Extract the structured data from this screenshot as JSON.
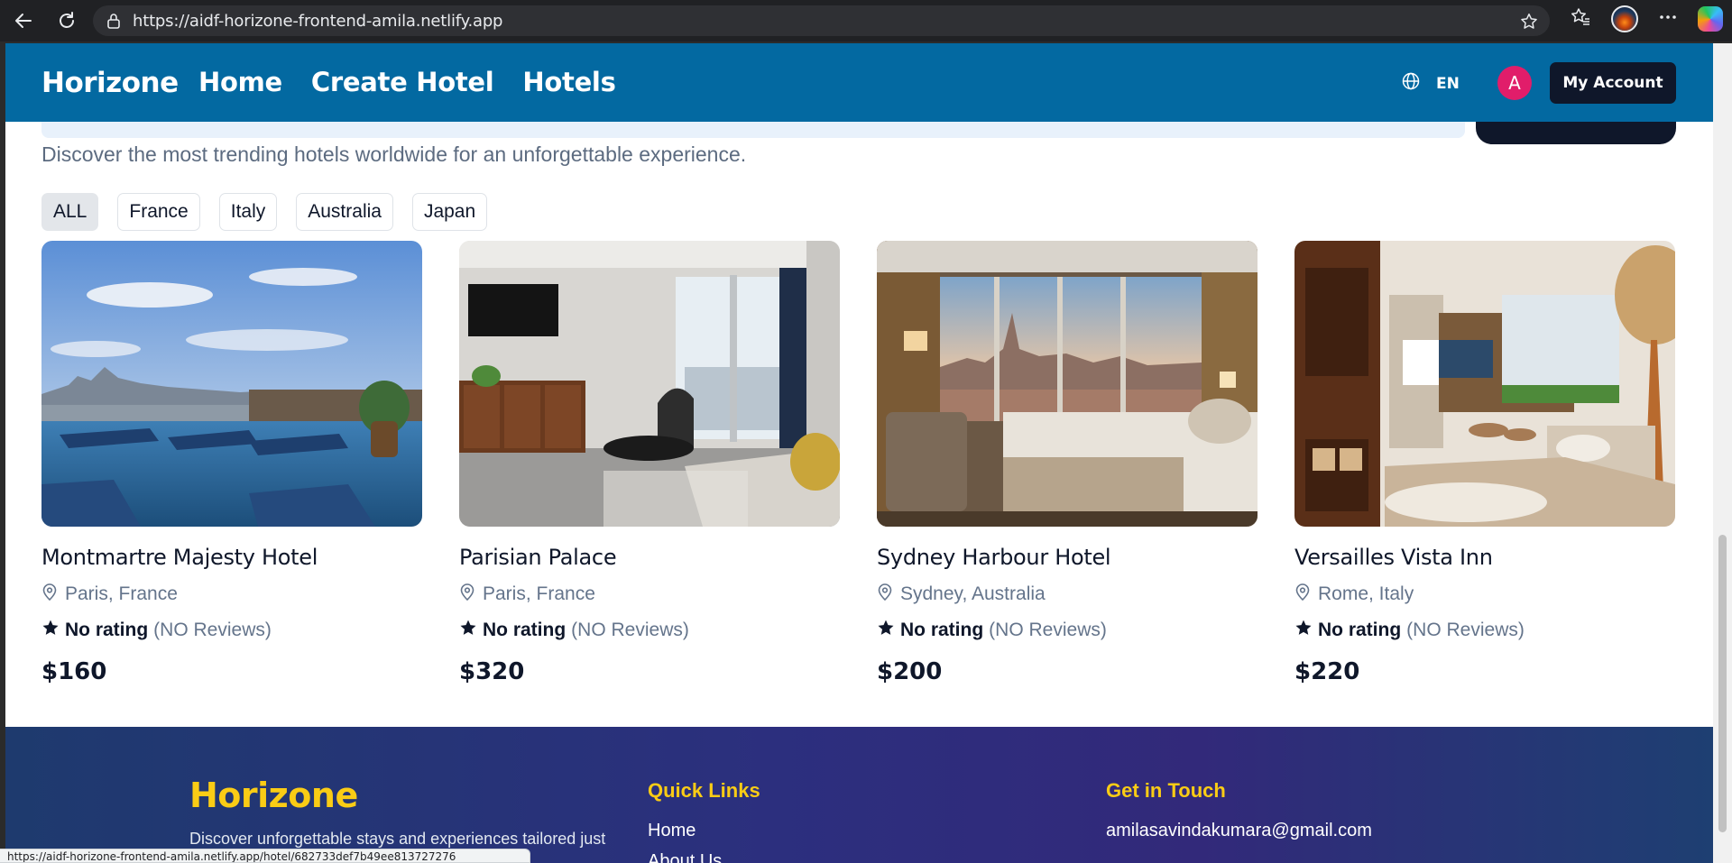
{
  "browser": {
    "url": "https://aidf-horizone-frontend-amila.netlify.app",
    "status_url": "https://aidf-horizone-frontend-amila.netlify.app/hotel/682733def7b49ee813727276"
  },
  "navbar": {
    "brand": "Horizone",
    "links": [
      "Home",
      "Create Hotel",
      "Hotels"
    ],
    "language": "EN",
    "avatar_initial": "A",
    "account_label": "My Account",
    "color": "#0369a1"
  },
  "main": {
    "subtitle": "Discover the most trending hotels worldwide for an unforgettable experience.",
    "filters": [
      {
        "label": "ALL",
        "active": true
      },
      {
        "label": "France",
        "active": false
      },
      {
        "label": "Italy",
        "active": false
      },
      {
        "label": "Australia",
        "active": false
      },
      {
        "label": "Japan",
        "active": false
      }
    ],
    "hotels": [
      {
        "name": "Montmartre Majesty Hotel",
        "location": "Paris, France",
        "rating_label": "No rating",
        "reviews": "(NO Reviews)",
        "price": "$160",
        "photo": "rooftop-pool-image"
      },
      {
        "name": "Parisian Palace",
        "location": "Paris, France",
        "rating_label": "No rating",
        "reviews": "(NO Reviews)",
        "price": "$320",
        "photo": "living-room-image"
      },
      {
        "name": "Sydney Harbour Hotel",
        "location": "Sydney, Australia",
        "rating_label": "No rating",
        "reviews": "(NO Reviews)",
        "price": "$200",
        "photo": "city-view-bedroom-image"
      },
      {
        "name": "Versailles Vista Inn",
        "location": "Rome, Italy",
        "rating_label": "No rating",
        "reviews": "(NO Reviews)",
        "price": "$220",
        "photo": "suite-lounge-image"
      }
    ]
  },
  "footer": {
    "brand": "Horizone",
    "description": "Discover unforgettable stays and experiences tailored just",
    "quick_links_title": "Quick Links",
    "quick_links": [
      "Home",
      "About Us"
    ],
    "contact_title": "Get in Touch",
    "email": "amilasavindakumara@gmail.com",
    "accent": "#facc15"
  }
}
